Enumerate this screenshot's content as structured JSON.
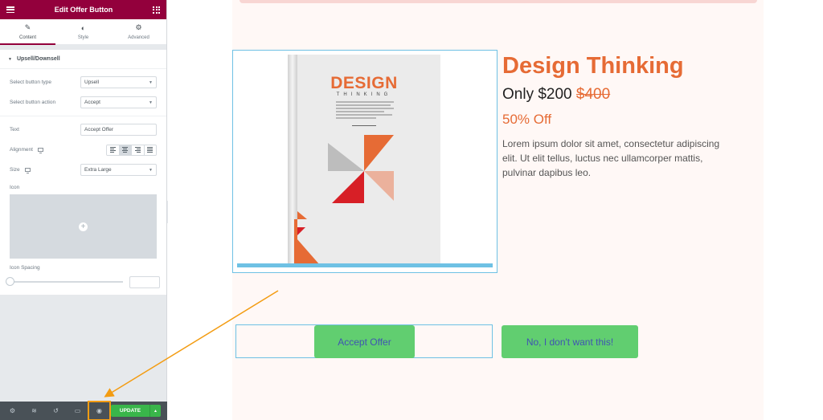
{
  "panel": {
    "title": "Edit Offer Button",
    "tabs": [
      {
        "label": "Content",
        "icon": "pencil-icon"
      },
      {
        "label": "Style",
        "icon": "half-circle-icon"
      },
      {
        "label": "Advanced",
        "icon": "gear-icon"
      }
    ],
    "section_title": "Upsell/Downsell",
    "controls": {
      "button_type": {
        "label": "Select button type",
        "value": "Upsell"
      },
      "button_action": {
        "label": "Select button action",
        "value": "Accept"
      },
      "text": {
        "label": "Text",
        "value": "Accept Offer"
      },
      "alignment": {
        "label": "Alignment",
        "selected": "center"
      },
      "size": {
        "label": "Size",
        "value": "Extra Large"
      },
      "icon": {
        "label": "Icon"
      },
      "icon_spacing": {
        "label": "Icon Spacing",
        "value": ""
      }
    },
    "footer": {
      "icons": [
        "gear-icon",
        "layers-icon",
        "history-icon",
        "responsive-icon",
        "eye-icon"
      ],
      "update_label": "UPDATE"
    }
  },
  "page": {
    "product": {
      "title": "Design Thinking",
      "price_prefix": "Only ",
      "price_new": "$200",
      "price_old": "$400",
      "discount": "50% Off",
      "description": "Lorem ipsum dolor sit amet, consectetur adipiscing elit. Ut elit tellus, luctus nec ullamcorper mattis, pulvinar dapibus leo."
    },
    "book_cover": {
      "title": "DESIGN",
      "subtitle": "THINKING"
    },
    "buttons": {
      "accept": "Accept Offer",
      "decline": "No, I don't want this!"
    }
  },
  "colors": {
    "panel_header": "#93003c",
    "accent_orange": "#e66b35",
    "button_green": "#61ce70",
    "button_text": "#4054b2",
    "frame_blue": "#6ec1e4",
    "annotation_arrow": "#f39c12"
  }
}
